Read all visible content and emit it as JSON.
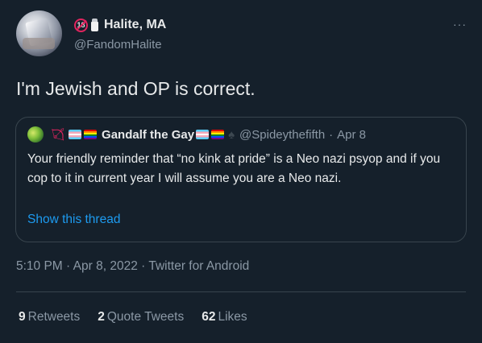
{
  "author": {
    "display_name": "Halite, MA",
    "handle": "@FandomHalite",
    "badge_text": "18",
    "emoji": [
      "no-under-18-icon",
      "salt-shaker-icon"
    ]
  },
  "tweet": {
    "text": "I'm Jewish and OP is correct."
  },
  "quoted": {
    "display_name": "Gandalf the Gay",
    "handle": "@Spideythefifth",
    "separator": "·",
    "date": "Apr 8",
    "text": "Your friendly reminder that “no kink at pride” is a Neo nazi psyop and if you cop to it in current year I will assume you are a Neo nazi.",
    "show_thread": "Show this thread",
    "emoji": [
      "bow-and-arrow-icon",
      "trans-flag-icon",
      "rainbow-flag-icon",
      "trans-flag-icon",
      "rainbow-flag-icon",
      "spade-icon"
    ]
  },
  "meta": {
    "time": "5:10 PM",
    "sep1": "·",
    "date": "Apr 8, 2022",
    "sep2": "·",
    "source": "Twitter for Android"
  },
  "stats": {
    "retweets": {
      "count": "9",
      "label": "Retweets"
    },
    "quote_tweets": {
      "count": "2",
      "label": "Quote Tweets"
    },
    "likes": {
      "count": "62",
      "label": "Likes"
    }
  },
  "more_icon": "···",
  "colors": {
    "background": "#15202b",
    "text": "#e7e9ea",
    "secondary": "#8b98a5",
    "link": "#1d9bf0",
    "border": "#38444d"
  }
}
